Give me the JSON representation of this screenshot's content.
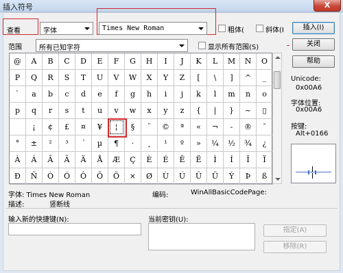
{
  "window": {
    "title": "插入符号",
    "close_glyph": "X"
  },
  "toolbar": {
    "view_label": "查看",
    "view_value": "字体",
    "font_value": "Times New Roman",
    "bold_label": "粗体(",
    "italic_label": "斜体(I",
    "insert_button": "插入(I)",
    "range_label": "范围",
    "range_value": "所有已知字符",
    "show_all_label": "显示所有范围(S)",
    "close_button": "关闭",
    "help_button": "帮助"
  },
  "grid": {
    "rows": [
      [
        "@",
        "A",
        "B",
        "C",
        "D",
        "E",
        "F",
        "G",
        "H",
        "I",
        "J",
        "K",
        "L",
        "M",
        "N",
        "O"
      ],
      [
        "P",
        "Q",
        "R",
        "S",
        "T",
        "U",
        "V",
        "W",
        "X",
        "Y",
        "Z",
        "[",
        "\\",
        "]",
        "^",
        "_"
      ],
      [
        "`",
        "a",
        "b",
        "c",
        "d",
        "e",
        "f",
        "g",
        "h",
        "i",
        "j",
        "k",
        "l",
        "m",
        "n",
        "o"
      ],
      [
        "p",
        "q",
        "r",
        "s",
        "t",
        "u",
        "v",
        "w",
        "x",
        "y",
        "z",
        "{",
        "|",
        "}",
        "~",
        "▯"
      ],
      [
        "",
        "¡",
        "¢",
        "£",
        "¤",
        "¥",
        "¦",
        "§",
        "¨",
        "©",
        "ª",
        "«",
        "¬",
        "-",
        "®",
        "¯"
      ],
      [
        "°",
        "±",
        "²",
        "³",
        "´",
        "µ",
        "¶",
        "·",
        "¸",
        "¹",
        "º",
        "»",
        "¼",
        "½",
        "¾",
        "¿"
      ],
      [
        "À",
        "Á",
        "Â",
        "Ã",
        "Ä",
        "Å",
        "Æ",
        "Ç",
        "È",
        "É",
        "Ê",
        "Ë",
        "Ì",
        "Í",
        "Î",
        "Ï"
      ],
      [
        "Ð",
        "Ñ",
        "Ò",
        "Ó",
        "Ô",
        "Õ",
        "Ö",
        "×",
        "Ø",
        "Ù",
        "Ú",
        "Û",
        "Ü",
        "Ý",
        "Þ",
        "ß"
      ]
    ],
    "selected": {
      "row": 4,
      "col": 6
    }
  },
  "info": {
    "unicode_label": "Unicode:",
    "unicode_value": "0x00A6",
    "font_pos_label": "字体位置:",
    "font_pos_value": "0x00A6",
    "key_label": "按键:",
    "key_value": "Alt+0166"
  },
  "details": {
    "font_line": "字体: Times New Roman",
    "encoding_line": "编码:",
    "encoding_value": "WinAllBasicCodePage:",
    "desc_line": "描述:",
    "desc_value": "竖断线"
  },
  "shortcut": {
    "new_key_label": "输入新的快捷键(N):",
    "current_key_label": "当前密钥(U):",
    "assign_button": "指定(A)",
    "remove_button": "移除(R)"
  }
}
